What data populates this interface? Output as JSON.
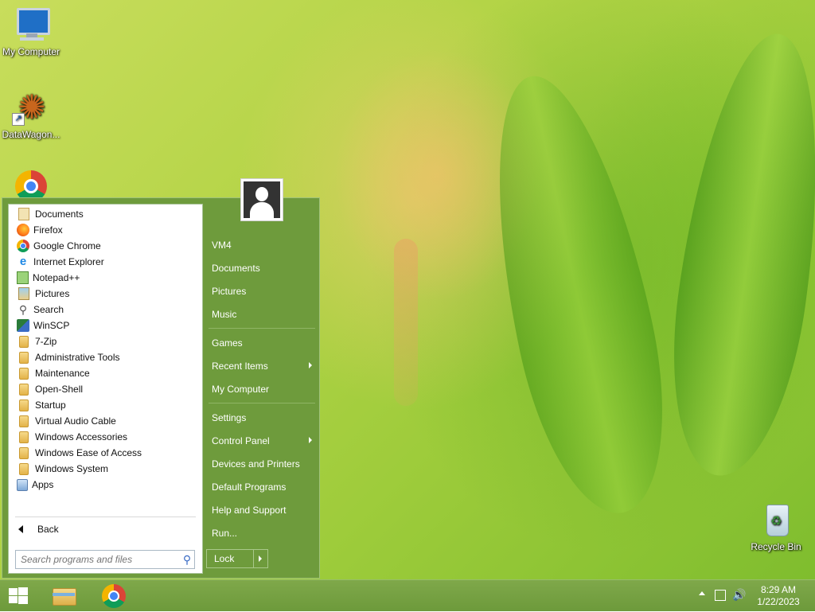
{
  "desktop": {
    "icons": [
      {
        "label": "My Computer"
      },
      {
        "label": "DataWagon..."
      },
      {
        "label": ""
      },
      {
        "label": "Recycle Bin"
      }
    ]
  },
  "start_menu": {
    "programs": [
      {
        "label": "Documents",
        "icon": "documents-icon"
      },
      {
        "label": "Firefox",
        "icon": "firefox-icon"
      },
      {
        "label": "Google Chrome",
        "icon": "chrome-icon"
      },
      {
        "label": "Internet Explorer",
        "icon": "internet-explorer-icon"
      },
      {
        "label": "Notepad++",
        "icon": "notepad-plus-plus-icon"
      },
      {
        "label": "Pictures",
        "icon": "pictures-icon"
      },
      {
        "label": "Search",
        "icon": "search-icon"
      },
      {
        "label": "WinSCP",
        "icon": "winscp-icon"
      },
      {
        "label": "7-Zip",
        "icon": "folder-icon"
      },
      {
        "label": "Administrative Tools",
        "icon": "folder-icon"
      },
      {
        "label": "Maintenance",
        "icon": "folder-icon"
      },
      {
        "label": "Open-Shell",
        "icon": "folder-icon"
      },
      {
        "label": "Startup",
        "icon": "folder-icon"
      },
      {
        "label": "Virtual Audio Cable",
        "icon": "folder-icon"
      },
      {
        "label": "Windows Accessories",
        "icon": "folder-icon"
      },
      {
        "label": "Windows Ease of Access",
        "icon": "folder-icon"
      },
      {
        "label": "Windows System",
        "icon": "folder-icon"
      },
      {
        "label": "Apps",
        "icon": "apps-icon"
      }
    ],
    "back_label": "Back",
    "search_placeholder": "Search programs and files",
    "right_items": {
      "vm4": "VM4",
      "documents": "Documents",
      "pictures": "Pictures",
      "music": "Music",
      "games": "Games",
      "recent_items": "Recent Items",
      "my_computer": "My Computer",
      "settings": "Settings",
      "control_panel": "Control Panel",
      "devices_printers": "Devices and Printers",
      "default_programs": "Default Programs",
      "help_support": "Help and Support",
      "run": "Run..."
    },
    "lock_label": "Lock"
  },
  "taskbar": {
    "time": "8:29 AM",
    "date": "1/22/2023"
  },
  "colors": {
    "start_menu_bg": "#6e9b3c",
    "taskbar_bg": "#7fa84a"
  }
}
